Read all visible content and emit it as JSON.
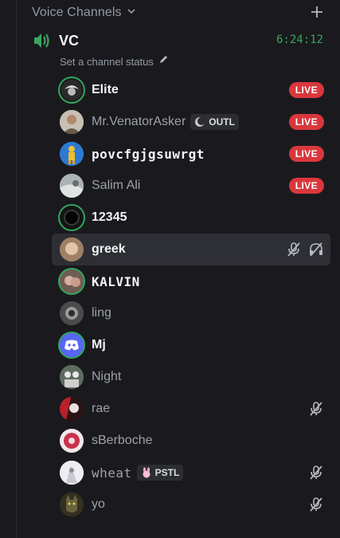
{
  "section": {
    "title": "Voice Channels",
    "add_icon": "plus-icon",
    "collapse_icon": "chevron-down-icon"
  },
  "channel": {
    "name": "VC",
    "timer": "6:24:12",
    "status_placeholder": "Set a channel status",
    "icon": "speaker-icon",
    "color_accent": "#3ba55c"
  },
  "users": [
    {
      "name": "Elite",
      "live": "LIVE"
    },
    {
      "name": "Mr.VenatorAsker",
      "tag": "OUTL",
      "live": "LIVE"
    },
    {
      "name": "povcfgjgsuwrgt",
      "live": "LIVE"
    },
    {
      "name": "Salim Ali",
      "live": "LIVE"
    },
    {
      "name": "12345"
    },
    {
      "name": "greek",
      "icons": [
        "mic-muted-icon",
        "headset-deafened-icon"
      ]
    },
    {
      "name": "KALVIN"
    },
    {
      "name": "ling"
    },
    {
      "name": "Mj"
    },
    {
      "name": "Night"
    },
    {
      "name": "rae",
      "icons": [
        "mic-muted-icon"
      ]
    },
    {
      "name": "sBerboche"
    },
    {
      "name": "wheat",
      "tag": "PSTL",
      "icons": [
        "mic-muted-icon"
      ]
    },
    {
      "name": "yo",
      "icons": [
        "mic-muted-icon"
      ]
    }
  ],
  "colors": {
    "live": "#da373c",
    "speaking": "#2fa85c",
    "discord_blurple": "#5865f2"
  }
}
